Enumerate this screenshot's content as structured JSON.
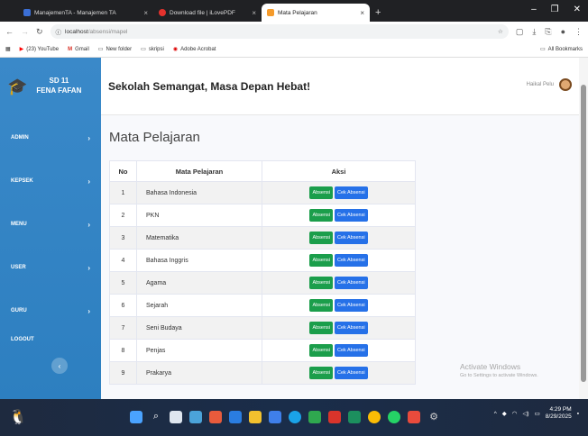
{
  "browser": {
    "tabs": [
      {
        "title": "ManajemenTA - Manajemen TA",
        "active": false
      },
      {
        "title": "Download file | iLovePDF",
        "active": false
      },
      {
        "title": "Mata Pelajaran",
        "active": true
      }
    ],
    "url_host": "localhost",
    "url_path": "/absensi/mapel",
    "bookmarks": [
      "(23) YouTube",
      "Gmail",
      "New folder",
      "skripsi",
      "Adobe Acrobat"
    ],
    "all_bookmarks": "All Bookmarks"
  },
  "sidebar": {
    "brand_line1": "SD 11",
    "brand_line2": "FENA FAFAN",
    "items": [
      {
        "label": "ADMIN"
      },
      {
        "label": "KEPSEK"
      },
      {
        "label": "MENU"
      },
      {
        "label": "USER"
      },
      {
        "label": "GURU"
      },
      {
        "label": "LOGOUT"
      }
    ]
  },
  "topbar": {
    "slogan": "Sekolah Semangat, Masa Depan Hebat!",
    "user_name": "Haikal Pelu"
  },
  "main": {
    "title": "Mata Pelajaran",
    "columns": [
      "No",
      "Mata Pelajaran",
      "Aksi"
    ],
    "btn_absensi": "Absensi",
    "btn_cek": "Cek Absensi",
    "rows": [
      {
        "no": "1",
        "mapel": "Bahasa Indonesia"
      },
      {
        "no": "2",
        "mapel": "PKN"
      },
      {
        "no": "3",
        "mapel": "Matematika"
      },
      {
        "no": "4",
        "mapel": "Bahasa Inggris"
      },
      {
        "no": "5",
        "mapel": "Agama"
      },
      {
        "no": "6",
        "mapel": "Sejarah"
      },
      {
        "no": "7",
        "mapel": "Seni Budaya"
      },
      {
        "no": "8",
        "mapel": "Penjas"
      },
      {
        "no": "9",
        "mapel": "Prakarya"
      }
    ]
  },
  "watermark": {
    "line1": "Activate Windows",
    "line2": "Go to Settings to activate Windows."
  },
  "taskbar": {
    "time": "4:29 PM",
    "date": "8/29/2025"
  }
}
